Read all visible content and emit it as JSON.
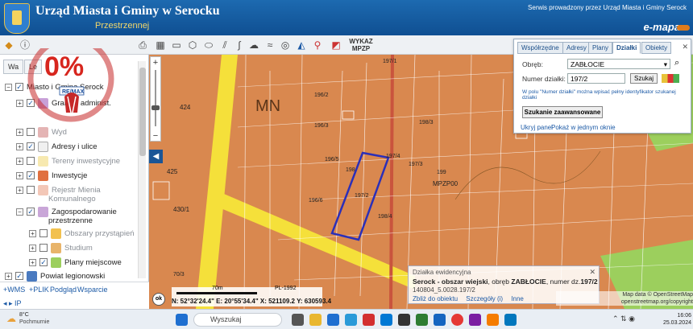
{
  "header": {
    "title": "Urząd Miasta i Gminy w Serocku",
    "subtitle": "Przestrzennej",
    "serwis": "Serwis prowadzony przez Urząd Miasta i Gminy Serock",
    "emapa": "e-mapa"
  },
  "toolbar": {
    "wykaz_line1": "WYKAZ",
    "wykaz_line2": "MPZP"
  },
  "panel": {
    "tabs": [
      "Wa",
      "Le"
    ],
    "items": [
      {
        "label": "Miasto i Gmina Serock",
        "checked": true
      },
      {
        "label": "Granice administ.",
        "checked": true
      },
      {
        "label": "Wyd",
        "checked": false
      },
      {
        "label": "Adresy i ulice",
        "checked": true
      },
      {
        "label": "Tereny inwestycyjne",
        "checked": false
      },
      {
        "label": "Inwestycje",
        "checked": true
      },
      {
        "label": "Rejestr Mienia",
        "checked": false
      },
      {
        "label": "Komunalnego",
        "checked": false
      },
      {
        "label": "Zagospodarowanie",
        "checked": true
      },
      {
        "label": "przestrzenne",
        "checked": true
      },
      {
        "label": "Obszary przystąpień",
        "checked": false
      },
      {
        "label": "Studium",
        "checked": false
      },
      {
        "label": "Plany miejscowe",
        "checked": true
      },
      {
        "label": "Powiat legionowski",
        "checked": true
      }
    ],
    "footer_links": [
      "+WMS",
      "+PLIK",
      "Podgląd",
      "Wsparcie"
    ],
    "footer_ip": "IP"
  },
  "promo": {
    "big_text": "0%",
    "ring_text": "BEZ PROWIZJI OD KUPUJĄCEGO · CAŁOŚĆ WYNAGRODZENIA POKRYWA WŁAŚCICIEL NIERUCHOMOŚCI",
    "logo": "RE/MAX"
  },
  "map": {
    "labels": [
      "MN",
      "424",
      "425",
      "430/1",
      "196/2",
      "196/5",
      "198",
      "197/4",
      "197/3",
      "197/2",
      "198/3",
      "199",
      "MPZP00",
      "196/6",
      "198/4",
      "197/1",
      "196/3",
      "70/3"
    ],
    "colors": {
      "parcel_fill": "#d9884f",
      "road_yellow": "#f5e03a",
      "highlight": "#2b2fb8",
      "green": "#9ccf5d",
      "parcel_line": "#ffffff"
    }
  },
  "search": {
    "tabs": [
      "Współrzędne",
      "Adresy",
      "Plany",
      "Działki",
      "Obiekty"
    ],
    "active_tab": "Działki",
    "obreb_label": "Obręb:",
    "obreb_value": "ZABŁOCIE",
    "numer_label": "Numer działki:",
    "numer_value": "197/2",
    "szukaj_label": "Szukaj",
    "hint": "W polu \"Numer działki\" można wpisać pełny identyfikator szukanej działki",
    "adv_label": "Szukanie zaawansowane",
    "ukryj": "Ukryj panel",
    "pokaz": "Pokaż w jednym oknie"
  },
  "info_popup": {
    "title": "Działka ewidencyjna",
    "line1_bold": "Serock - obszar wiejski",
    "line1_rest": ", obręb ",
    "obreb": "ZABŁOCIE",
    "line1_tail": ", numer dz.",
    "numer": "197/2",
    "line2": "140804_5.0028.197/2",
    "links": [
      "Zbliż do obiektu",
      "Szczegóły (i)",
      "Inne"
    ]
  },
  "scale": {
    "label": "70m",
    "crs": "PL-1992"
  },
  "coords": {
    "text": "N: 52°32'24.4\"  E: 20°55'34.4\"  X: 521109.2  Y: 630593.4"
  },
  "attribution": {
    "line1": "Map data © OpenStreetMap",
    "line2": "openstreetmap.org/copyright"
  },
  "taskbar": {
    "temp": "8°C",
    "condition": "Pochmurnie",
    "search_placeholder": "Wyszukaj",
    "time": "16:06",
    "date": "25.03.2024"
  }
}
